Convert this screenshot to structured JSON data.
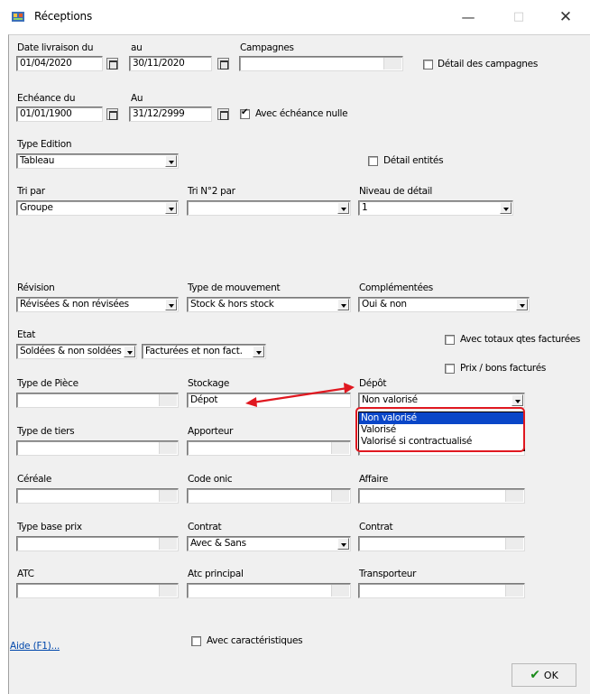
{
  "window": {
    "title": "Réceptions",
    "minimize": "—",
    "maximize": "□",
    "close": "✕"
  },
  "fields": {
    "date_livraison_du": {
      "label": "Date livraison du",
      "value": "01/04/2020"
    },
    "date_livraison_au": {
      "label": "au",
      "value": "30/11/2020"
    },
    "campagnes": {
      "label": "Campagnes",
      "value": ""
    },
    "detail_campagnes": {
      "label": "Détail des campagnes",
      "checked": false
    },
    "echeance_du": {
      "label": "Echéance du",
      "value": "01/01/1900"
    },
    "echeance_au": {
      "label": "Au",
      "value": "31/12/2999"
    },
    "avec_echeance_nulle": {
      "label": "Avec échéance nulle",
      "checked": true
    },
    "type_edition": {
      "label": "Type Edition",
      "value": "Tableau"
    },
    "detail_entites": {
      "label": "Détail entités",
      "checked": false
    },
    "tri_par": {
      "label": "Tri par",
      "value": "Groupe"
    },
    "tri_n2_par": {
      "label": "Tri N°2 par",
      "value": ""
    },
    "niveau_detail": {
      "label": "Niveau de détail",
      "value": "1"
    },
    "revision": {
      "label": "Révision",
      "value": "Révisées & non révisées"
    },
    "type_mouvement": {
      "label": "Type de mouvement",
      "value": "Stock & hors stock"
    },
    "complementees": {
      "label": "Complémentées",
      "value": "Oui & non"
    },
    "etat": {
      "label": "Etat",
      "value1": "Soldées & non soldées",
      "value2": "Facturées et non fact."
    },
    "avec_totaux_qtes": {
      "label": "Avec totaux qtes facturées",
      "checked": false
    },
    "prix_bons_factures": {
      "label": "Prix / bons facturés",
      "checked": false
    },
    "type_piece": {
      "label": "Type de Pièce",
      "value": ""
    },
    "stockage": {
      "label": "Stockage",
      "value": "Dépot"
    },
    "depot": {
      "label": "Dépôt",
      "value": "Non valorisé",
      "options": [
        "Non valorisé",
        "Valorisé",
        "Valorisé si contractualisé"
      ]
    },
    "type_tiers": {
      "label": "Type de tiers",
      "value": ""
    },
    "apporteur": {
      "label": "Apporteur",
      "value": ""
    },
    "cereale": {
      "label": "Céréale",
      "value": ""
    },
    "code_onic": {
      "label": "Code onic",
      "value": ""
    },
    "affaire": {
      "label": "Affaire",
      "value": ""
    },
    "type_base_prix": {
      "label": "Type base prix",
      "value": ""
    },
    "contrat_select": {
      "label": "Contrat",
      "value": "Avec & Sans"
    },
    "contrat_lookup": {
      "label": "Contrat",
      "value": ""
    },
    "atc": {
      "label": "ATC",
      "value": ""
    },
    "atc_principal": {
      "label": "Atc principal",
      "value": ""
    },
    "transporteur": {
      "label": "Transporteur",
      "value": ""
    },
    "avec_caracteristiques": {
      "label": "Avec caractéristiques",
      "checked": false
    }
  },
  "footer": {
    "help_link": "Aide (F1)...",
    "ok_label": "OK"
  },
  "colors": {
    "dialog_bg": "#f0f0f0",
    "highlight": "#0a46c8",
    "annotation_red": "#e01820",
    "link": "#0047ab",
    "ok_check": "#1a8a1a"
  },
  "icons": {
    "app": "receptions-app-icon",
    "calendar": "calendar-icon",
    "dropdown": "chevron-down-icon",
    "check": "green-checkmark-icon"
  }
}
